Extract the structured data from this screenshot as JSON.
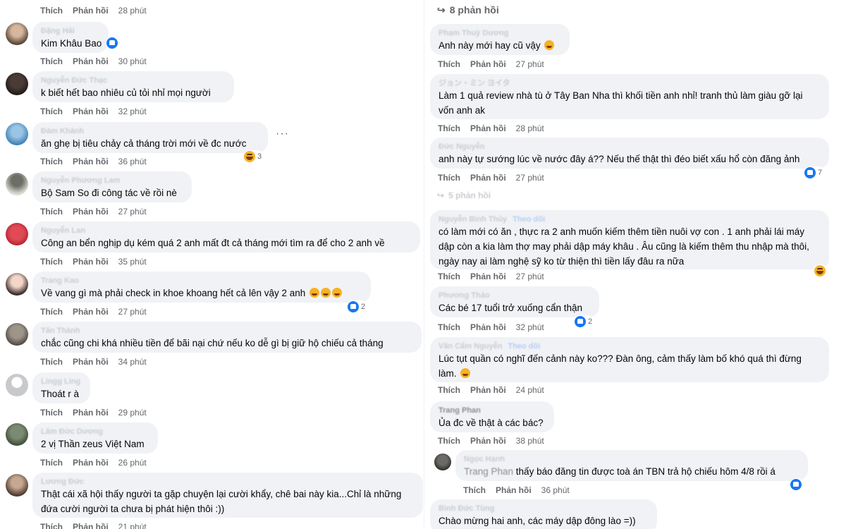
{
  "labels": {
    "like": "Thích",
    "reply": "Phản hồi"
  },
  "left_column": [
    {
      "author": "",
      "text": "",
      "time": "28 phút"
    },
    {
      "author": "Đặng Hải",
      "text": "Kim Khâu Bao",
      "time": "30 phút",
      "reaction_count": ""
    },
    {
      "author": "Nguyễn Đức Thạc",
      "text": "k biết hết bao nhiêu củ tỏi nhỉ mọi người",
      "time": "32 phút"
    },
    {
      "author": "Đàm Khánh",
      "text": "ăn ghẹ bị tiêu chảy cả tháng trời mới về đc nước",
      "time": "36 phút",
      "reaction_count": "3",
      "more_label": "···"
    },
    {
      "author": "Nguyễn Phương Lam",
      "text": "Bộ Sam So đi công tác về rồi nè",
      "time": "27 phút"
    },
    {
      "author": "Nguyễn Lan",
      "text": "Công an bển nghịp dụ kém quá 2 anh mất đt cả tháng mới tìm ra để cho 2 anh về",
      "time": "35 phút"
    },
    {
      "author": "Trang Kao",
      "text": "Về vang gì mà phải check in khoe khoang hết cả lên vậy 2 anh",
      "time": "27 phút",
      "reaction_count": "2"
    },
    {
      "author": "Tấn Thành",
      "text": "chắc cũng chi khá nhiều tiền để bãi nại chứ nếu ko dễ gì bị giữ hộ chiếu cả tháng",
      "time": "34 phút"
    },
    {
      "author": "Lingg Ling",
      "text": "Thoát r à",
      "time": "29 phút"
    },
    {
      "author": "Lâm Đức Dương",
      "text": "2 vị Thần zeus Việt Nam",
      "time": "26 phút"
    },
    {
      "author": "Lương Đức",
      "text": "Thật cái xã hội thấy người ta gặp chuyện lại cười khẩy, chê bai này kia...Chỉ là những đứa cười người ta chưa bị phát hiện thôi :))",
      "time": "21 phút"
    }
  ],
  "right_column": {
    "replies_header": "8 phản hồi",
    "comments": [
      {
        "author": "Phạm Thuỳ Dương",
        "text": "Anh này mới hay cũ vậy",
        "time": "27 phút"
      },
      {
        "author": "ジョン・ミン ヨイタ",
        "text": "Làm 1 quả review nhà tù ở Tây Ban Nha thì khối tiền anh nhỉ! tranh thủ làm giàu gỡ lại vốn anh ak",
        "time": "28 phút"
      },
      {
        "author": "Đức Nguyễn",
        "text": "anh này tự sướng lúc về nước đây á?? Nếu thế thật thì đéo biết xấu hổ còn đăng ảnh",
        "time": "27 phút",
        "reaction_count": "7"
      },
      {
        "author": "Nguyễn Bình Thủy",
        "follow": "Theo dõi",
        "text": "có làm mới có ăn , thực ra 2 anh muốn kiếm thêm tiền nuôi vợ con . 1 anh phải lái máy dập còn a kia làm thợ may phải dập máy khâu . Âu cũng là kiếm thêm thu nhập mà thôi, ngày nay ai làm nghệ sỹ ko từ thiện thì tiền lấy đâu ra nữa",
        "time": "27 phút"
      },
      {
        "author": "Phương Thảo",
        "text": "Các bé 17 tuổi trở xuống cẩn thận",
        "time": "32 phút",
        "reaction_count": "2"
      },
      {
        "author": "Văn Cẩm Nguyễn",
        "follow": "Theo dõi",
        "text": "Lúc tụt quần có nghĩ đến cảnh này ko??? Đàn ông, cảm thấy làm bố khó quá thì đừng làm.",
        "time": "24 phút"
      },
      {
        "author": "Trang Phan",
        "text": "Ủa đc về thật à các bác?",
        "time": "38 phút"
      },
      {
        "author": "Ngọc Hạnh",
        "mention": "Trang Phan",
        "text": " thấy báo đăng tin được toà án TBN trả hộ chiếu hôm 4/8 rồi á",
        "time": "36 phút"
      },
      {
        "author": "Bình Đức Tùng",
        "text": "Chào mừng hai anh, các máy dập đông lào =))",
        "time": ""
      }
    ],
    "sub_replies": "5 phản hồi"
  },
  "colors": {
    "bubble": "#f0f2f5",
    "meta": "#65676b",
    "like_blue": "#1877f2",
    "haha_yellow": "#f7b125"
  }
}
